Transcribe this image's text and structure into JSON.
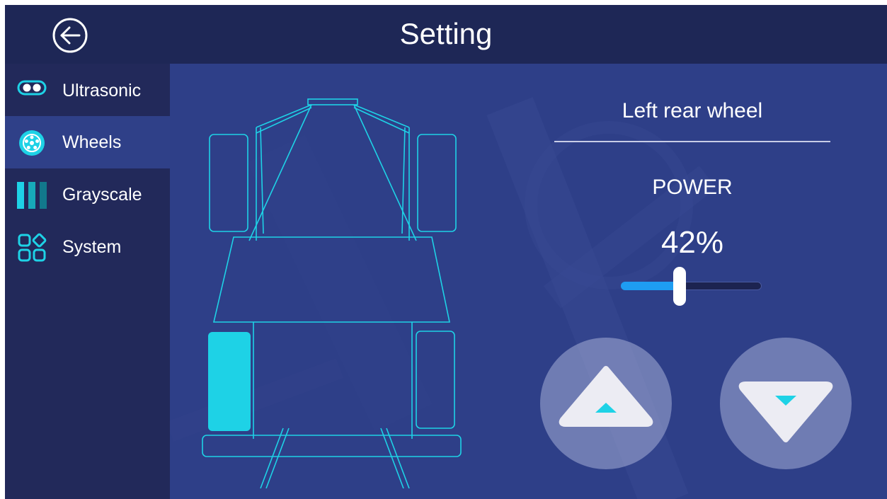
{
  "header": {
    "title": "Setting",
    "back_icon": "back-arrow-icon"
  },
  "sidebar": {
    "items": [
      {
        "label": "Ultrasonic",
        "icon": "ultrasonic-icon",
        "active": false
      },
      {
        "label": "Wheels",
        "icon": "wheel-icon",
        "active": true
      },
      {
        "label": "Grayscale",
        "icon": "grayscale-icon",
        "active": false
      },
      {
        "label": "System",
        "icon": "system-icon",
        "active": false
      }
    ]
  },
  "main": {
    "selected_wheel": "Left rear wheel",
    "power_label": "POWER",
    "power_value": "42%",
    "power_fraction": 0.42,
    "up_icon": "triangle-up-icon",
    "down_icon": "triangle-down-icon"
  },
  "colors": {
    "accent": "#1ed2e6",
    "header_bg": "#1e2756",
    "main_bg": "#2e3f88",
    "active_nav": "#2f4088",
    "slider_fill": "#1e9df2"
  }
}
